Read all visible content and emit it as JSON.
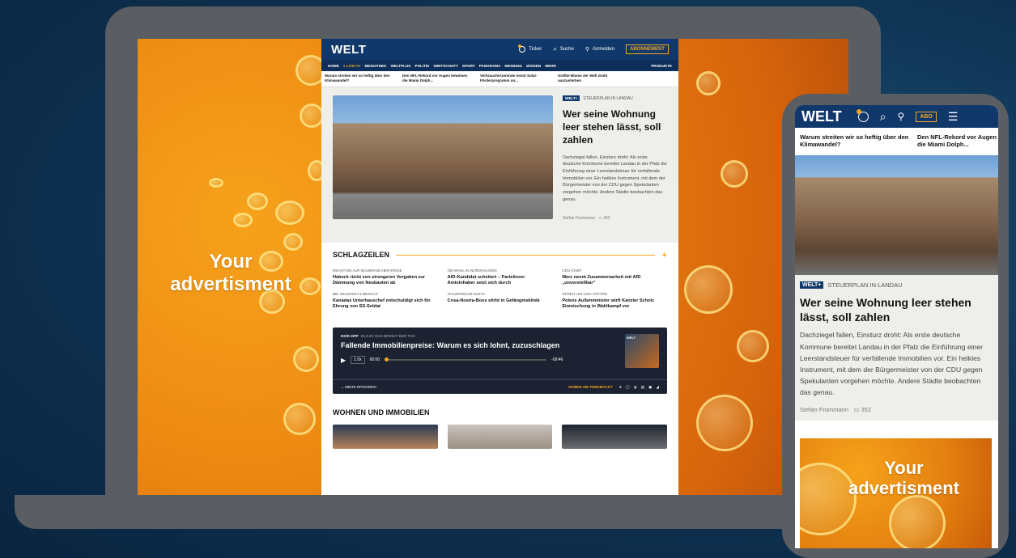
{
  "ad": {
    "line1": "Your",
    "line2": "advertisment"
  },
  "site": {
    "logo": "WELT",
    "ticker_label": "Ticker",
    "search_label": "Suche",
    "login_label": "Anmelden",
    "abo_label": "ABONNEMENT",
    "nav": [
      "HOME",
      "LIVE-TV",
      "MEDIATHEK",
      "WELTPLUS",
      "POLITIK",
      "WIRTSCHAFT",
      "SPORT",
      "PANORAMA",
      "MEINUNG",
      "WISSEN",
      "MEHR"
    ],
    "products_label": "PRODUKTE",
    "ticker_items": [
      "Warum streiten wir so heftig über den Klimawandel?",
      "Den NFL-Rekord vor Augen beweisen die Miami Dolph...",
      "Verbraucherzentrale nennt Solar-Förderprogramm un...",
      "Größte Blume der Welt droht auszusterben"
    ],
    "hero": {
      "badge": "WELT+",
      "kicker": "STEUERPLAN IN LANDAU",
      "title": "Wer seine Wohnung leer stehen lässt, soll zahlen",
      "body": "Dachziegel fallen, Einsturz droht: Als erste deutsche Kommune bereitet Landau in der Pfalz die Einführung einer Leerstandsteuer für verfallende Immobilien vor. Ein heikles Instrument, mit dem der Bürgermeister von der CDU gegen Spekulanten vorgehen möchte. Andere Städte beobachten das genau.",
      "author": "Stefan Frommann",
      "comments": "352"
    },
    "schlagzeilen": {
      "title": "SCHLAGZEILEN",
      "items": [
        {
          "kicker": "REAKTION AUF BAUBRANCHEN-KRISE",
          "title": "Habeck rückt von strengeren Vorgaben zur Dämmung von Neubauten ab"
        },
        {
          "kicker": "OB-WAHL IN NORDHAUSEN",
          "title": "AfD-Kandidat scheitert – Parteiloser Amtsinhaber setzt sich durch"
        },
        {
          "kicker": "CDU-CHEF",
          "title": "Merz nennt Zusammenarbeit mit AfD „unvorstellbar“"
        },
        {
          "kicker": "BEI SELENSKYJ-BESUCH",
          "title": "Kanadas Unterhauschef entschuldigt sich für Ehrung von SS-Soldat"
        },
        {
          "kicker": "ITALIENISCHE MAFIA",
          "title": "Cosa-Nostra-Boss stirbt in Gefängnisklinik"
        },
        {
          "kicker": "STREIT UM VISA-AFFÄRE",
          "title": "Polens Außenminister wirft Kanzler Scholz Einmischung in Wahlkampf vor"
        }
      ]
    },
    "podcast": {
      "show": "KICK-OFF",
      "kicker": "25.9.23: DAS BRINGT DER TAG",
      "title": "Fallende Immobilienpreise: Warum es sich lohnt, zuzuschlagen",
      "speed": "1.0x",
      "time_current": "00:00",
      "time_remaining": "-09:46",
      "more_label": "MEHR EPISODEN",
      "feedback_label": "HABEN SIE FEEDBACK?",
      "art_label": "WELT"
    },
    "section2_title": "WOHNEN UND IMMOBILIEN"
  },
  "phone": {
    "logo": "WELT",
    "abo_label": "ABO",
    "ticker_items": [
      "Warum streiten wir so heftig über den Klimawandel?",
      "Den NFL-Rekord vor Augen beweisen die Miami Dolph..."
    ],
    "badge": "WELT+",
    "kicker": "STEUERPLAN IN LANDAU",
    "title": "Wer seine Wohnung leer stehen lässt, soll zahlen",
    "body": "Dachziegel fallen, Einsturz droht: Als erste deutsche Kommune bereitet Landau in der Pfalz die Einführung einer Leerstandsteuer für verfallende Immobilien vor. Ein heikles Instrument, mit dem der Bürgermeister von der CDU gegen Spekulanten vorgehen möchte. Andere Städte beobachten das genau.",
    "author": "Stefan Frommann",
    "comments": "352"
  },
  "colors": {
    "brand": "#11386b",
    "accent": "#f5a623",
    "ad_orange": "#ee8a12"
  }
}
